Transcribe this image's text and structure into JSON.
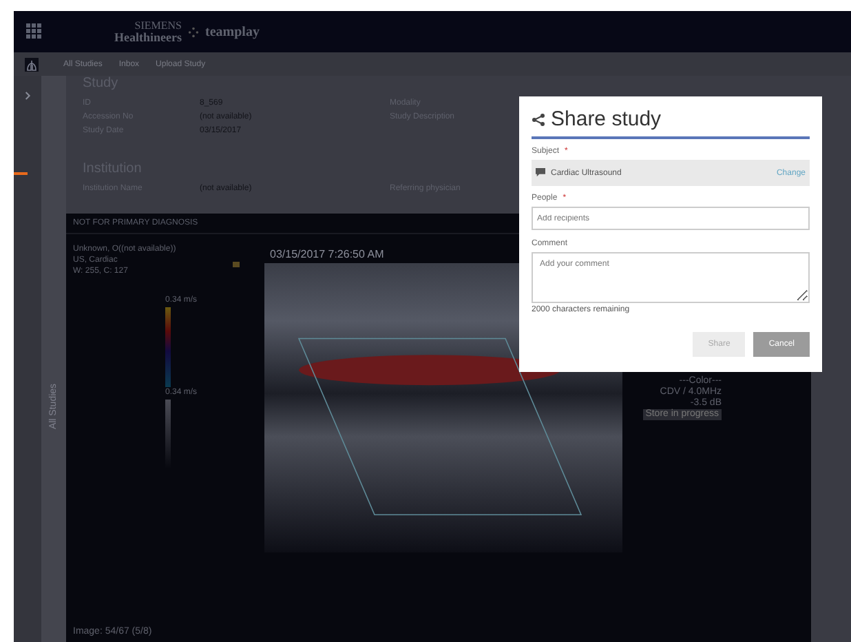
{
  "top_bar": {
    "brand_line1": "SIEMENS",
    "brand_line2": "Healthineers",
    "product": "teamplay"
  },
  "nav": {
    "tabs": [
      {
        "label": "All Studies"
      },
      {
        "label": "Inbox"
      },
      {
        "label": "Upload Study"
      }
    ]
  },
  "side_panel": {
    "label": "All Studies"
  },
  "study": {
    "heading": "Study",
    "fields": [
      {
        "label": "ID",
        "value": "8_569"
      },
      {
        "label": "Accession No",
        "value": "(not available)"
      },
      {
        "label": "Study Date",
        "value": "03/15/2017"
      }
    ],
    "right_labels": [
      "Modality",
      "Study Description"
    ]
  },
  "institution": {
    "heading": "Institution",
    "fields": [
      {
        "label": "Institution Name",
        "value": "(not available)"
      }
    ],
    "right_labels": [
      "Referring physician"
    ]
  },
  "viewer": {
    "banner": "NOT FOR PRIMARY DIAGNOSIS",
    "patient_lines": [
      "Unknown, O((not available))",
      "US, Cardiac",
      "W: 255, C: 127"
    ],
    "timestamp": "03/15/2017 7:26:50 AM",
    "scale_top": "0.34 m/s",
    "scale_bottom": "0.34 m/s",
    "info_lines": [
      "---Color---",
      "CDV / 4.0MHz",
      "-3.5 dB"
    ],
    "status": "Store in progress",
    "footer": "Image: 54/67 (5/8)"
  },
  "dialog": {
    "title": "Share study",
    "required_mark": "*",
    "subject_label": "Subject",
    "subject_value": "Cardiac Ultrasound",
    "change_link": "Change",
    "people_label": "People",
    "people_placeholder": "Add recipients",
    "comment_label": "Comment",
    "comment_placeholder": "Add your comment",
    "remaining": "2000 characters remaining",
    "buttons": [
      {
        "label": "Share",
        "disabled": true
      },
      {
        "label": "Cancel",
        "disabled": false
      }
    ]
  }
}
